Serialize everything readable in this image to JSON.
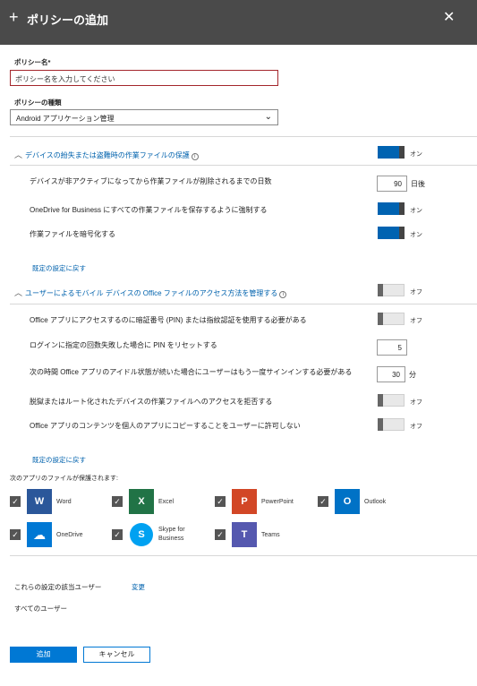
{
  "header": {
    "title": "ポリシーの追加",
    "plus_glyph": "+",
    "close_glyph": "✕"
  },
  "policy_name": {
    "label": "ポリシー名",
    "required_mark": "*",
    "value": "ポリシー名を入力してください"
  },
  "policy_type": {
    "label": "ポリシーの種類",
    "selected": "Android アプリケーション管理"
  },
  "section1": {
    "title": "デバイスの紛失または盗難時の作業ファイルの保護",
    "master_toggle": "オン",
    "rows": [
      {
        "label": "デバイスが非アクティブになってから作業ファイルが削除されるまでの日数",
        "value": "90",
        "unit": "日後"
      },
      {
        "label": "OneDrive for Business にすべての作業ファイルを保存するように強制する",
        "toggle": "オン"
      },
      {
        "label": "作業ファイルを暗号化する",
        "toggle": "オン"
      }
    ],
    "reset_link": "既定の設定に戻す"
  },
  "section2": {
    "title": "ユーザーによるモバイル デバイスの Office ファイルのアクセス方法を管理する",
    "master_toggle": "オフ",
    "rows": [
      {
        "label": "Office アプリにアクセスするのに暗証番号 (PIN) または指紋認証を使用する必要がある",
        "toggle": "オフ"
      },
      {
        "label": "ログインに指定の回数失敗した場合に PIN をリセットする",
        "value": "5"
      },
      {
        "label": "次の時間 Office アプリのアイドル状態が続いた場合にユーザーはもう一度サインインする必要がある",
        "value": "30",
        "unit": "分"
      },
      {
        "label": "脱獄またはルート化されたデバイスの作業ファイルへのアクセスを拒否する",
        "toggle": "オフ"
      },
      {
        "label": "Office アプリのコンテンツを個人のアプリにコピーすることをユーザーに許可しない",
        "toggle": "オフ"
      }
    ],
    "reset_link": "既定の設定に戻す"
  },
  "apps": {
    "heading": "次のアプリのファイルが保護されます:",
    "items": [
      {
        "name": "Word",
        "color": "#2b579a",
        "glyph": "W"
      },
      {
        "name": "Excel",
        "color": "#217346",
        "glyph": "X"
      },
      {
        "name": "PowerPoint",
        "color": "#d24726",
        "glyph": "P"
      },
      {
        "name": "Outlook",
        "color": "#0072c6",
        "glyph": "O"
      },
      {
        "name": "OneDrive",
        "color": "#0078d4",
        "glyph": "☁"
      },
      {
        "name_line1": "Skype for",
        "name_line2": "Business",
        "color": "#00a1f1",
        "glyph": "S"
      },
      {
        "name": "Teams",
        "color": "#5558af",
        "glyph": "T"
      }
    ]
  },
  "assignment": {
    "label": "これらの設定の該当ユーザー",
    "change_link": "変更",
    "value": "すべてのユーザー"
  },
  "footer": {
    "add": "追加",
    "cancel": "キャンセル"
  }
}
